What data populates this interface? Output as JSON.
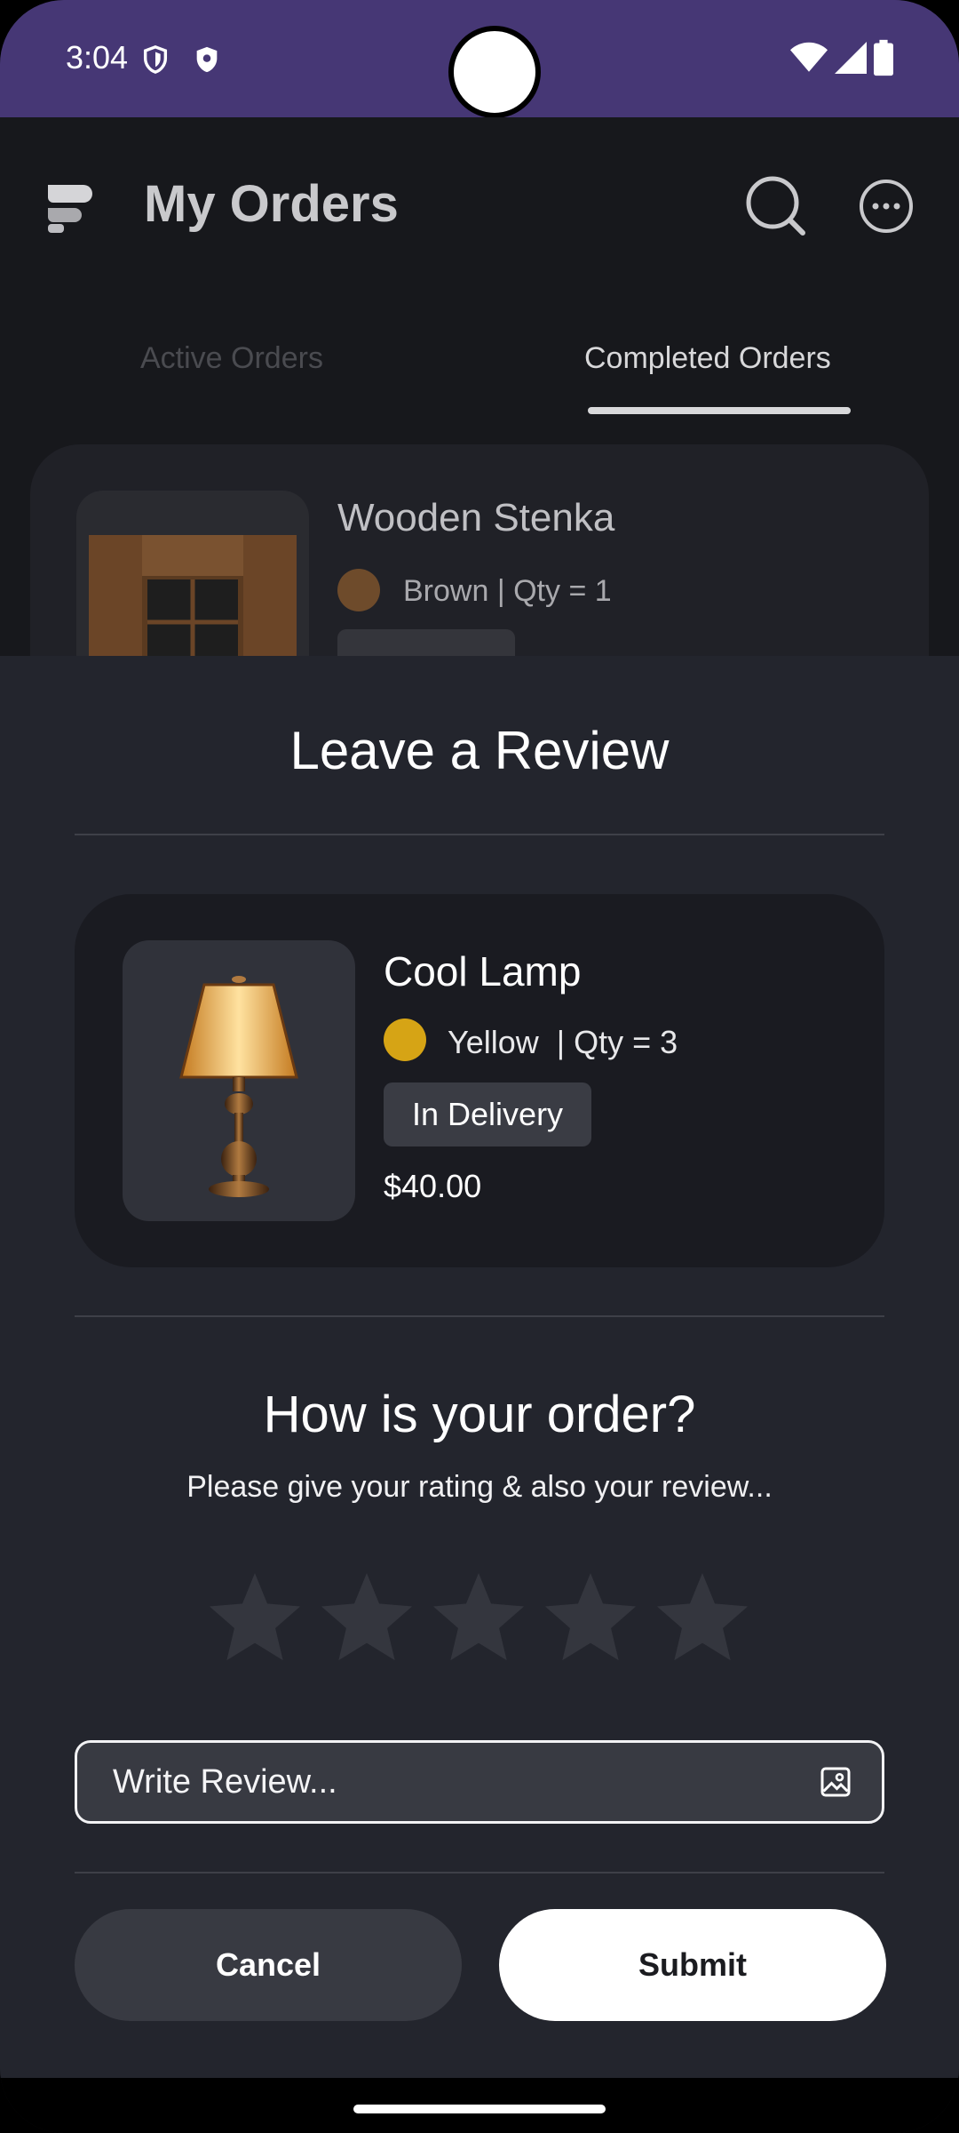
{
  "status_bar": {
    "time": "3:04"
  },
  "header": {
    "title": "My Orders"
  },
  "tabs": [
    {
      "label": "Active Orders",
      "active": false
    },
    {
      "label": "Completed Orders",
      "active": true
    }
  ],
  "background_order": {
    "name": "Wooden Stenka",
    "color_name": "Brown",
    "color_hex": "#6e4b2b",
    "qty_text": "| Qty = 1"
  },
  "review_sheet": {
    "title": "Leave a Review",
    "product": {
      "name": "Cool Lamp",
      "color_name": "Yellow",
      "color_hex": "#d6a415",
      "qty_text": "| Qty = 3",
      "status": "In Delivery",
      "price": "$40.00"
    },
    "question": "How is your order?",
    "subtitle": "Please give your rating & also your review...",
    "rating": {
      "value": 0,
      "max": 5
    },
    "review_placeholder": "Write Review...",
    "cancel_label": "Cancel",
    "submit_label": "Submit"
  },
  "colors": {
    "status_bar": "#463775",
    "background": "#17181c",
    "sheet": "#23252d",
    "star_empty": "#34363e"
  }
}
